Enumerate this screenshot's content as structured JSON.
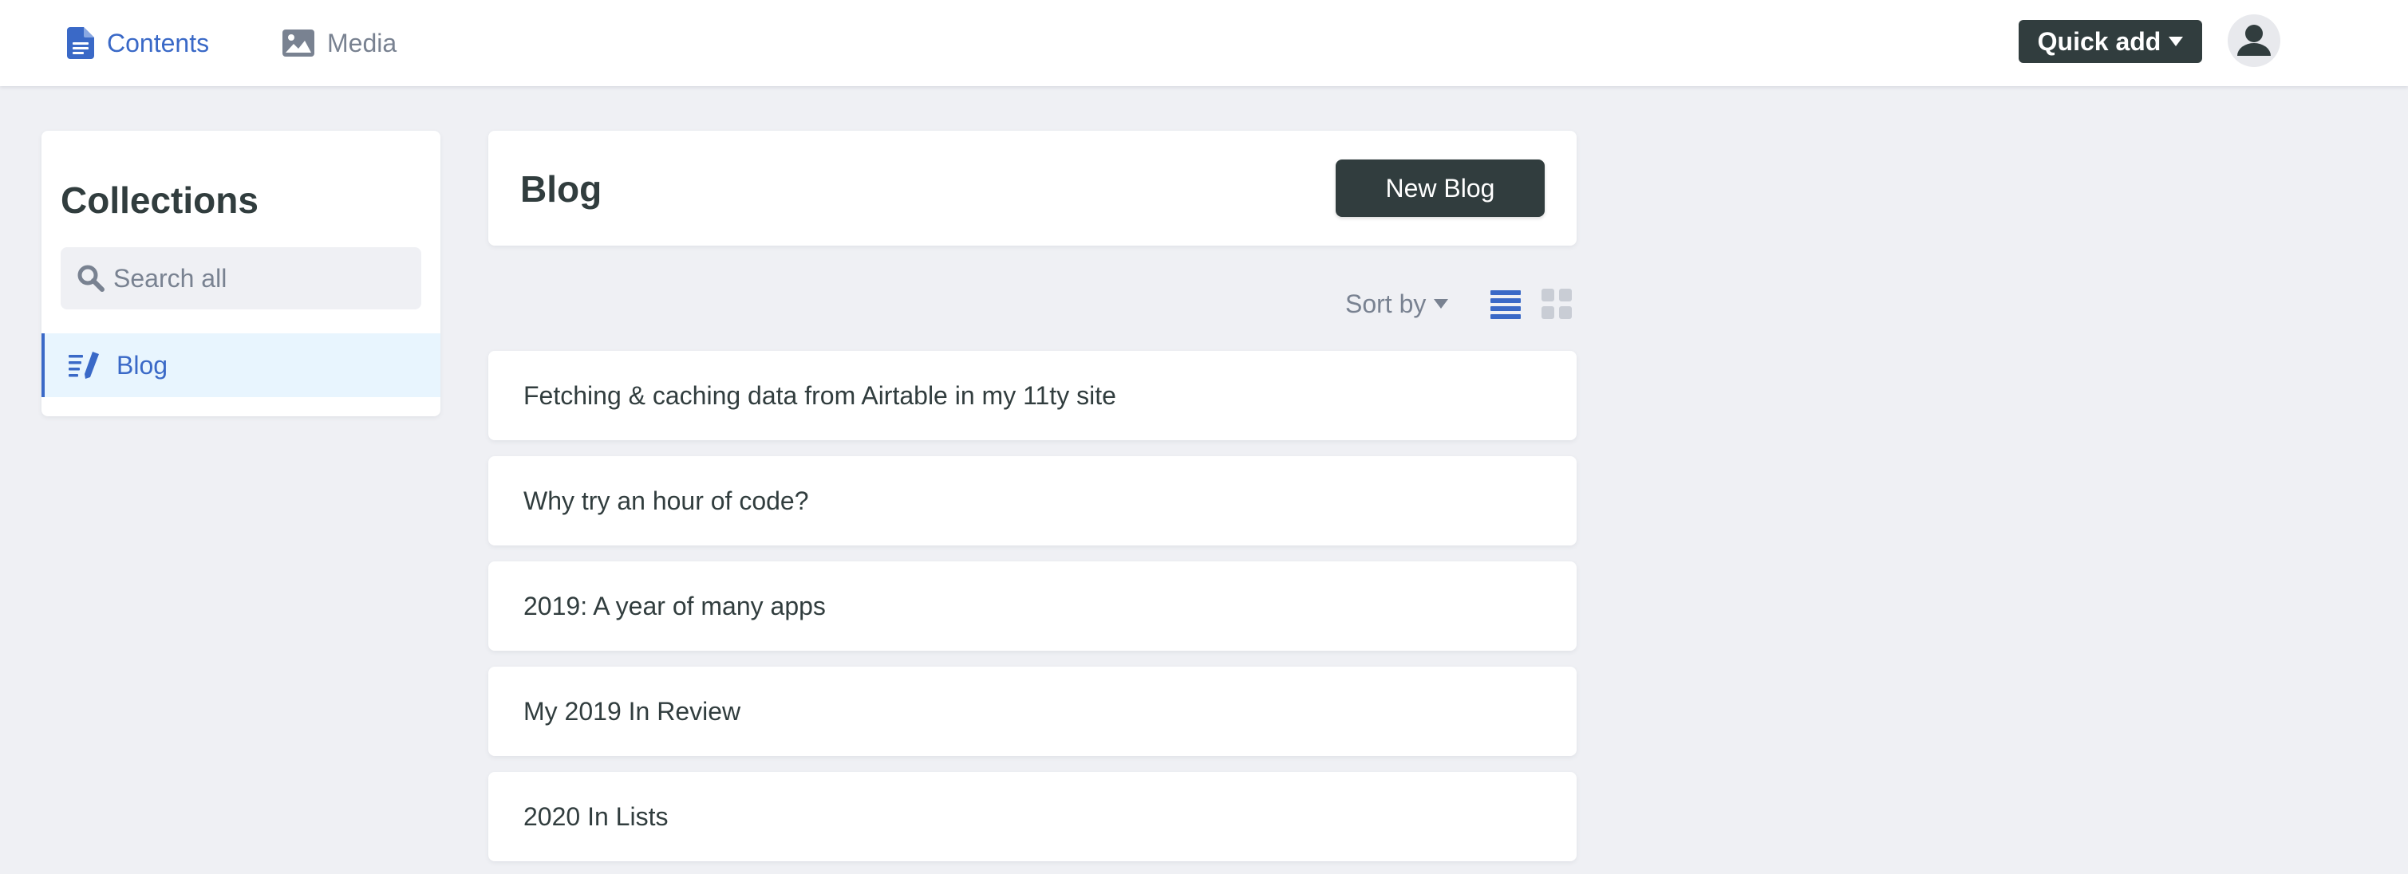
{
  "topbar": {
    "nav": [
      {
        "label": "Contents",
        "icon": "document-icon",
        "active": true
      },
      {
        "label": "Media",
        "icon": "image-icon",
        "active": false
      }
    ],
    "quick_add_label": "Quick add",
    "avatar_icon": "user-icon"
  },
  "sidebar": {
    "title": "Collections",
    "search_placeholder": "Search all",
    "collections": [
      {
        "label": "Blog",
        "icon": "edit-list-icon",
        "active": true
      }
    ]
  },
  "main": {
    "title": "Blog",
    "new_button_label": "New Blog",
    "sort_label": "Sort by",
    "view_mode": "list",
    "entries": [
      {
        "title": "Fetching & caching data from Airtable in my 11ty site"
      },
      {
        "title": "Why try an hour of code?"
      },
      {
        "title": "2019: A year of many apps"
      },
      {
        "title": "My 2019 In Review"
      },
      {
        "title": "2020 In Lists"
      }
    ]
  },
  "colors": {
    "accent": "#3a69c7",
    "dark": "#313d3e",
    "muted": "#798291",
    "background": "#eff0f4",
    "active_item_bg": "#e8f5fe"
  }
}
